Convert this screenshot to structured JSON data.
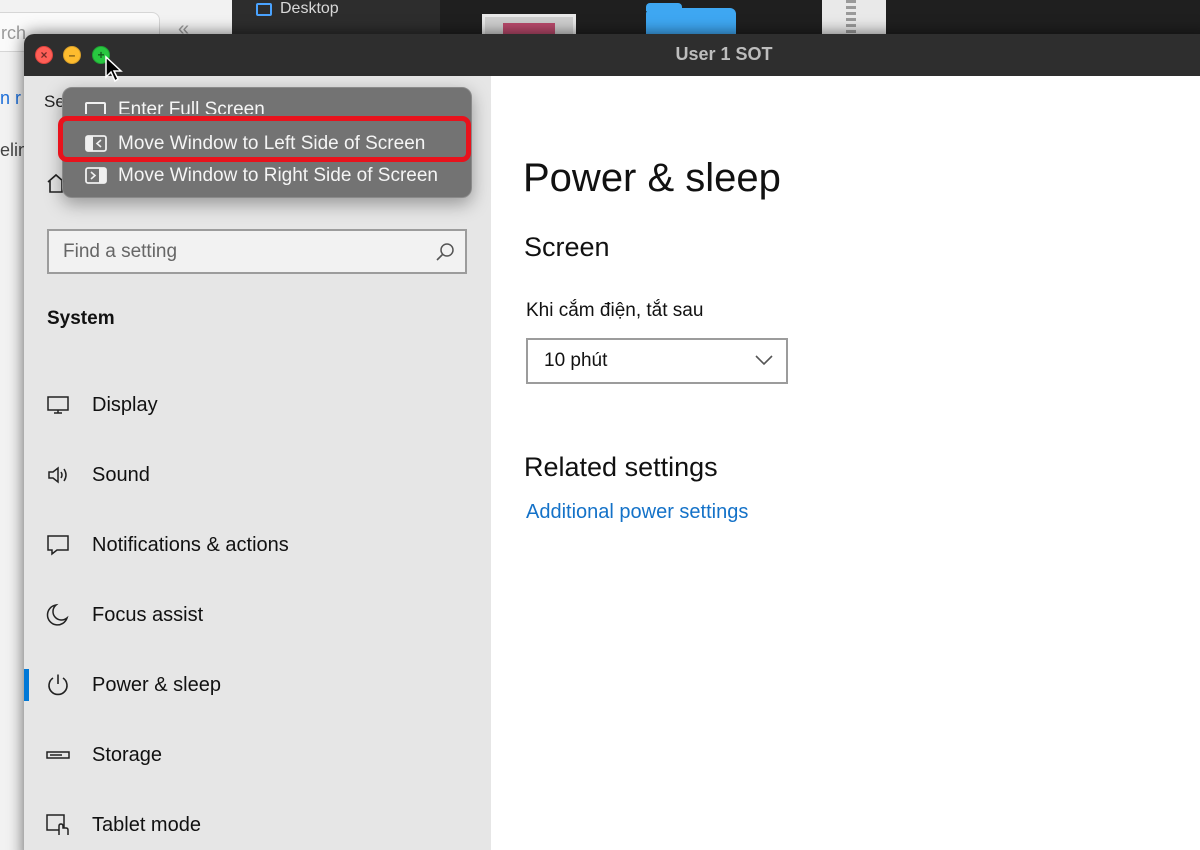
{
  "background": {
    "search_text": "rch",
    "chevron": "«",
    "fragment_1": "n r",
    "fragment_2": "elin",
    "desktop_label": "Desktop"
  },
  "window": {
    "title": "User 1 SOT"
  },
  "sidebar": {
    "settings_label": "Se",
    "search_placeholder": "Find a setting",
    "section_title": "System",
    "items": [
      {
        "label": "Display",
        "icon": "display-icon"
      },
      {
        "label": "Sound",
        "icon": "sound-icon"
      },
      {
        "label": "Notifications & actions",
        "icon": "notifications-icon"
      },
      {
        "label": "Focus assist",
        "icon": "focus-assist-icon"
      },
      {
        "label": "Power & sleep",
        "icon": "power-icon",
        "active": true
      },
      {
        "label": "Storage",
        "icon": "storage-icon"
      },
      {
        "label": "Tablet mode",
        "icon": "tablet-mode-icon"
      }
    ]
  },
  "content": {
    "page_title": "Power & sleep",
    "screen_heading": "Screen",
    "plugged_label": "Khi cắm điện, tắt sau",
    "plugged_value": "10 phút",
    "related_heading": "Related settings",
    "additional_link": "Additional power settings"
  },
  "menu": {
    "items": [
      {
        "label": "Enter Full Screen"
      },
      {
        "label": "Move Window to Left Side of Screen",
        "highlighted": true
      },
      {
        "label": "Move Window to Right Side of Screen"
      }
    ],
    "highlight_color": "#e8121c"
  },
  "colors": {
    "accent": "#0078d7",
    "link": "#1472c8",
    "close": "#ff5f57",
    "minimize": "#febc2e",
    "maximize": "#28c840"
  }
}
